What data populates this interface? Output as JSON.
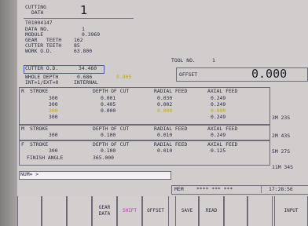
{
  "header": {
    "title_line1": "CUTTING",
    "title_line2": "DATA",
    "screen_number": "1"
  },
  "program_id": "T01004147",
  "params": [
    {
      "label": "DATA NO.",
      "value": "1"
    },
    {
      "label": "MODULE",
      "value": "0.3969"
    },
    {
      "label": "GEAR   TEETH",
      "value": "162"
    },
    {
      "label": "CUTTER TEETH",
      "value": "85"
    },
    {
      "label": "WORK O.D.",
      "value": "63.800"
    },
    {
      "label": "CUTTER O.D.",
      "value": "34.460"
    },
    {
      "label": "WHOLE DEPTH",
      "value": "0.686",
      "extra": "0.005"
    },
    {
      "label": "INT=1/EXT=0",
      "value": "INTERNAL"
    }
  ],
  "tool": {
    "label": "TOOL NO.",
    "value": "1"
  },
  "offset": {
    "label": "OFFSET",
    "value": "0.000"
  },
  "sections": {
    "R": {
      "code": "R",
      "headers": [
        "STROKE",
        "DEPTH OF CUT",
        "RADIAL FEED",
        "AXIAL FEED"
      ],
      "rows": [
        [
          "300",
          "0.001",
          "0.030",
          "0.249"
        ],
        [
          "300",
          "0.405",
          "0.002",
          "0.249"
        ],
        [
          "300",
          "0.000",
          "0.000",
          "0.090"
        ],
        [
          "300",
          "",
          "",
          "0.249"
        ]
      ],
      "time": "3M 23S"
    },
    "M": {
      "code": "M",
      "headers": [
        "STROKE",
        "DEPTH OF CUT",
        "RADIAL FEED",
        "AXIAL FEED"
      ],
      "rows": [
        [
          "300",
          "0.100",
          "0.010",
          "0.249"
        ]
      ],
      "time": "2M 43S"
    },
    "F": {
      "code": "F",
      "headers": [
        "STROKE",
        "DEPTH OF CUT",
        "RADIAL FEED",
        "AXIAL FEED"
      ],
      "rows": [
        [
          "300",
          "0.100",
          "0.010",
          "0.125"
        ]
      ],
      "time": "5M 27S"
    },
    "finish": {
      "label": "FINISH ANGLE",
      "value": "365.000"
    },
    "total_time": "11M 34S"
  },
  "input": {
    "prompt": "NUM= >"
  },
  "status": {
    "mode": "MEM",
    "dashes": "**** *** ***",
    "clock": "17:28:56"
  },
  "softkeys": [
    {
      "line1": "",
      "line2": ""
    },
    {
      "line1": "",
      "line2": ""
    },
    {
      "line1": "",
      "line2": ""
    },
    {
      "line1": "GEAR",
      "line2": "DATA"
    },
    {
      "line1": "SHIFT",
      "line2": ""
    },
    {
      "line1": "OFFSET",
      "line2": ""
    },
    {
      "line1": "SAVE",
      "line2": ""
    },
    {
      "line1": "READ",
      "line2": ""
    },
    {
      "line1": "",
      "line2": ""
    },
    {
      "line1": "",
      "line2": ""
    },
    {
      "line1": "INPUT",
      "line2": ""
    }
  ],
  "colors": {
    "screen": "#d2cdcd",
    "text": "#2a2a3a",
    "highlight": "#b9a623",
    "selection_border": "#4c58a8",
    "shift_key": "#b63cb0"
  }
}
